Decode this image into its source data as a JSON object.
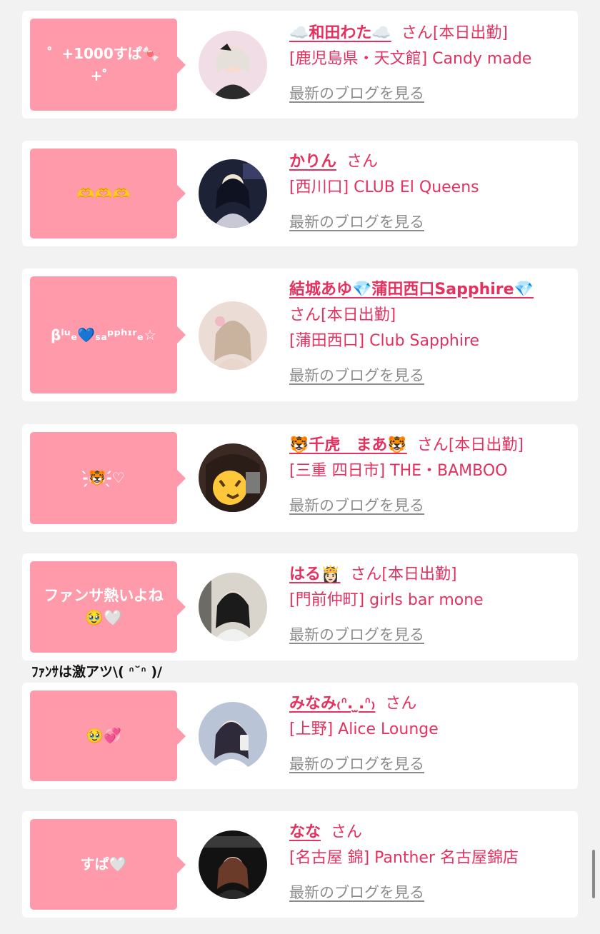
{
  "entries": [
    {
      "comment": "゜+1000すぱ🍬+゜",
      "name": "☁️和田わた☁️",
      "san": "さん",
      "status": "[本日出勤]",
      "shop": "[鹿児島県・天文館] Candy made",
      "blog": "最新のブログを見る"
    },
    {
      "comment": "🫶🫶🫶",
      "name": "かりん",
      "san": "さん",
      "status": "",
      "shop": "[西川口] CLUB El Queens",
      "blog": "最新のブログを見る"
    },
    {
      "comment": "βˡᵘₑ💙ₛₐᵖᵖʰᶦʳₑ☆",
      "name": "結城あゆ💎蒲田西口Sapphire💎",
      "san": "さん",
      "status": "[本日出勤]",
      "shop": "[蒲田西口] Club Sapphire",
      "blog": "最新のブログを見る"
    },
    {
      "comment": "-̗̀🐯-̖́♡",
      "name": "🐯千虎　まあ🐯",
      "san": "さん",
      "status": "[本日出勤]",
      "shop": "[三重 四日市] THE・BAMBOO",
      "blog": "最新のブログを見る"
    },
    {
      "comment": "ファンサ熱いよね🥹🤍",
      "name": "はる👸🏻",
      "san": "さん",
      "status": "[本日出勤]",
      "shop": "[門前仲町] girls bar mone",
      "blog": "最新のブログを見る"
    },
    {
      "comment": "🥹💞",
      "name": "みなみ₍ᐢ. ̫.ᐢ₎",
      "san": "さん",
      "status": "",
      "shop": "[上野] Alice Lounge",
      "blog": "最新のブログを見る"
    },
    {
      "comment": "すぱ🤍",
      "name": "なな",
      "san": "さん",
      "status": "",
      "shop": "[名古屋 錦] Panther 名古屋錦店",
      "blog": "最新のブログを見る"
    }
  ],
  "overflow_note": "ﾌｧﾝｻは激アツ\\( ᐢ˘ᐢ )/"
}
